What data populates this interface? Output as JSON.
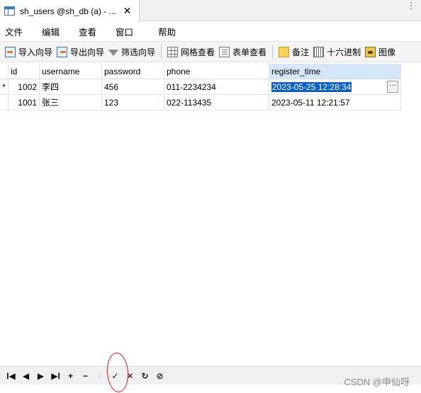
{
  "tab": {
    "title": "sh_users @sh_db (a) - ...",
    "close": "✕",
    "overflow": "⋮"
  },
  "menu": {
    "items": [
      "文件",
      "编辑",
      "查看",
      "窗口",
      "帮助"
    ]
  },
  "toolbar": {
    "import_label": "导入向导",
    "export_label": "导出向导",
    "filter_label": "筛选向导",
    "grid_view_label": "网格查看",
    "form_view_label": "表单查看",
    "memo_label": "备注",
    "hex_label": "十六进制",
    "image_label": "图像"
  },
  "table": {
    "columns": [
      "id",
      "username",
      "password",
      "phone",
      "register_time"
    ],
    "rows": [
      {
        "marker": "*",
        "id": "1002",
        "username": "李四",
        "password": "456",
        "phone": "011-2234234",
        "register_time": "2023-05-25 12:28:34"
      },
      {
        "marker": "",
        "id": "1001",
        "username": "张三",
        "password": "123",
        "phone": "022-113435",
        "register_time": "2023-05-11 12:21:57"
      }
    ],
    "ellipsis": "···"
  },
  "nav": {
    "first": "I◀",
    "prev": "◀",
    "next": "▶",
    "last": "▶I",
    "add": "+",
    "delete": "−",
    "edit": "∕",
    "apply": "✓",
    "cancel": "✕",
    "refresh": "↻",
    "stop": "⊘"
  },
  "watermark": "CSDN @申仙呀",
  "colors": {
    "selection": "#0a60c8",
    "active_header": "#d4e6f7",
    "annotation_circle": "#e0151b"
  }
}
